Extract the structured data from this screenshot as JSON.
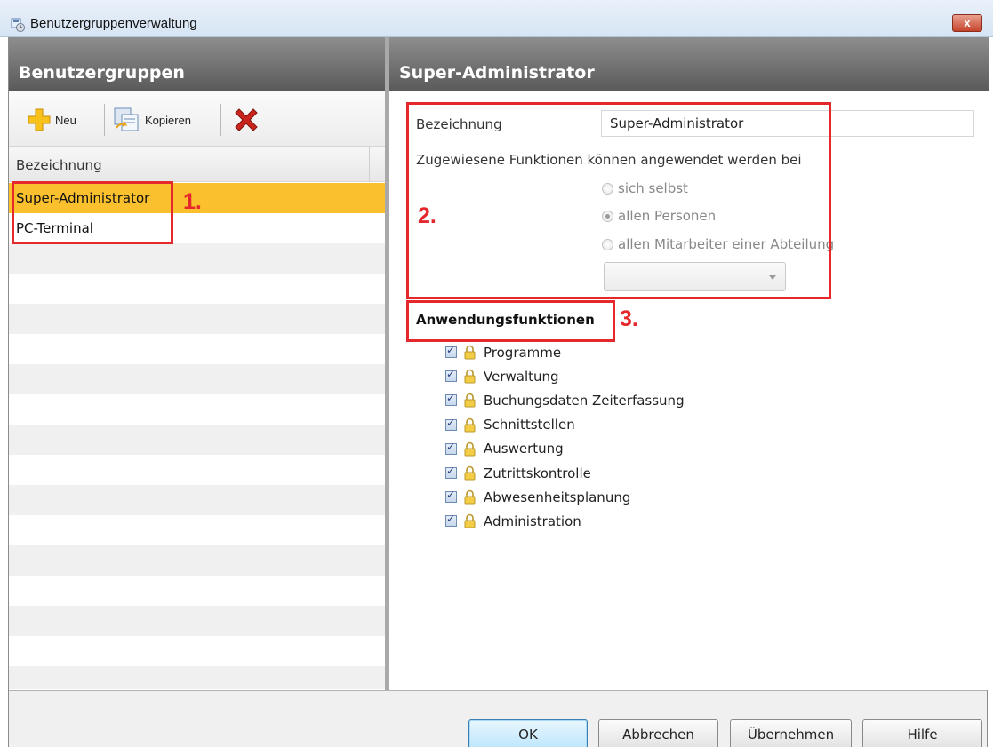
{
  "window": {
    "title": "Benutzergruppenverwaltung",
    "close_label": "x"
  },
  "left_pane": {
    "header": "Benutzergruppen",
    "toolbar": {
      "new_label": "Neu",
      "copy_label": "Kopieren"
    },
    "column_header": "Bezeichnung",
    "rows": [
      {
        "label": "Super-Administrator",
        "selected": true
      },
      {
        "label": "PC-Terminal",
        "selected": false
      }
    ]
  },
  "right_pane": {
    "header": "Super-Administrator",
    "name_label": "Bezeichnung",
    "name_value": "Super-Administrator",
    "scope_label": "Zugewiesene Funktionen können angewendet werden bei",
    "scope_options": [
      {
        "label": "sich selbst",
        "checked": false
      },
      {
        "label": "allen Personen",
        "checked": true
      },
      {
        "label": "allen Mitarbeiter einer Abteilung",
        "checked": false
      }
    ],
    "department_select_value": "",
    "functions_title": "Anwendungsfunktionen",
    "functions": [
      {
        "label": "Programme",
        "checked": true
      },
      {
        "label": "Verwaltung",
        "checked": true
      },
      {
        "label": "Buchungsdaten Zeiterfassung",
        "checked": true
      },
      {
        "label": "Schnittstellen",
        "checked": true
      },
      {
        "label": "Auswertung",
        "checked": true
      },
      {
        "label": "Zutrittskontrolle",
        "checked": true
      },
      {
        "label": "Abwesenheitsplanung",
        "checked": true
      },
      {
        "label": "Administration",
        "checked": true
      }
    ]
  },
  "annotations": {
    "one": "1.",
    "two": "2.",
    "three": "3."
  },
  "buttons": {
    "ok": "OK",
    "cancel": "Abbrechen",
    "apply": "Übernehmen",
    "help": "Hilfe"
  },
  "colors": {
    "selection": "#fbc02d",
    "annotation": "#e4282c",
    "header": "#6e6e6e"
  }
}
